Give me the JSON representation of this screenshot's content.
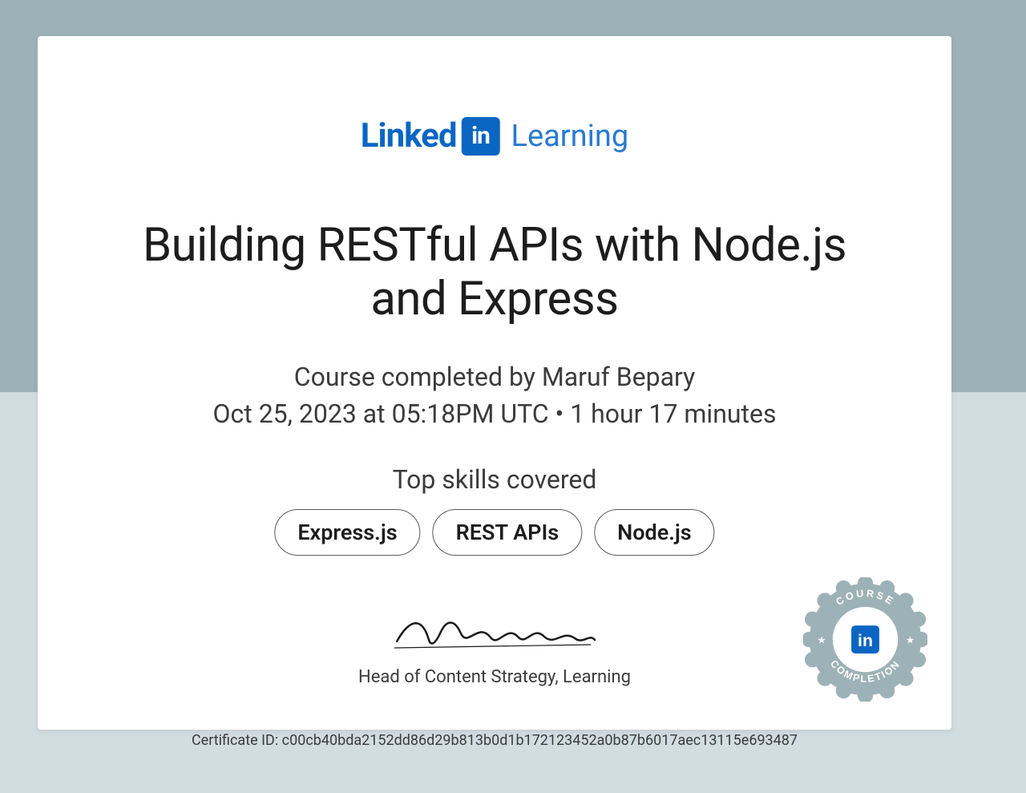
{
  "brand": {
    "linked": "Linked",
    "in": "in",
    "learning": "Learning"
  },
  "course_title": "Building RESTful APIs with Node.js and Express",
  "completed_by": "Course completed by Maruf Bepary",
  "completion_meta": "Oct 25, 2023 at 05:18PM UTC • 1 hour 17 minutes",
  "skills_label": "Top skills covered",
  "skills": [
    "Express.js",
    "REST APIs",
    "Node.js"
  ],
  "signer_title": "Head of Content Strategy, Learning",
  "certificate_id_label": "Certificate ID:",
  "certificate_id": "c00cb40bda2152dd86d29b813b0d1b172123452a0b87b6017aec13115e693487",
  "seal": {
    "top_text": "COURSE",
    "bottom_text": "COMPLETION"
  }
}
